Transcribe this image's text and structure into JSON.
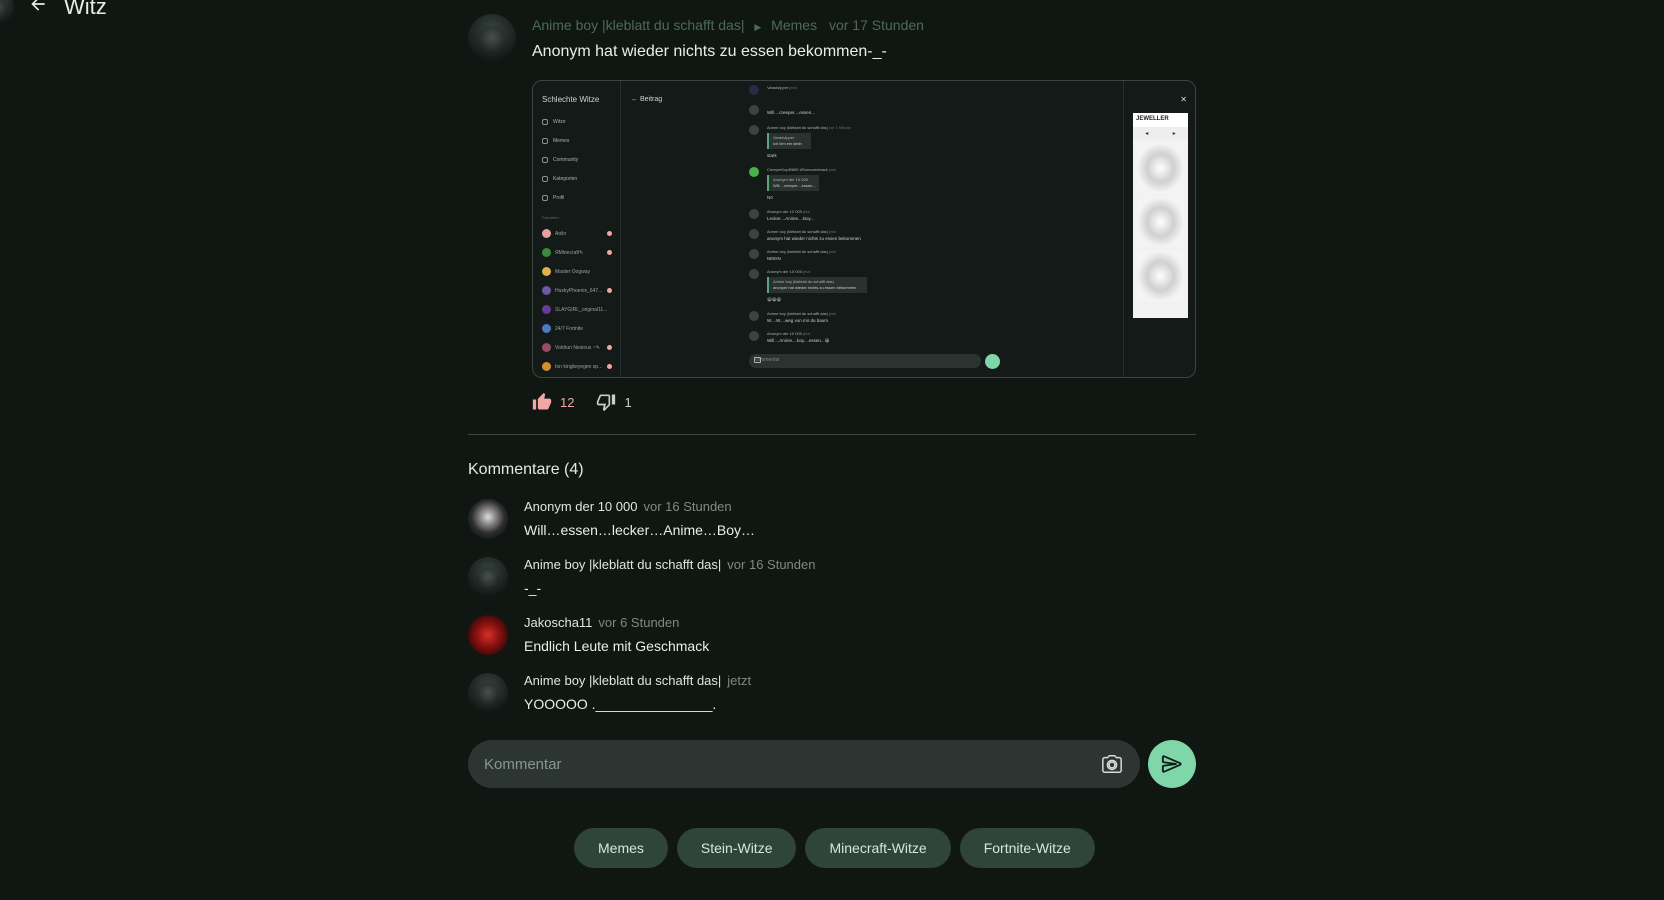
{
  "header": {
    "title": "Witz",
    "back_icon": "arrow-left-icon"
  },
  "post": {
    "author": "Anime boy |kleblatt du schafft das|",
    "category": "Memes",
    "time": "vor 17 Stunden",
    "text": "Anonym hat wieder nichts zu essen bekommen-_-",
    "likes": "12",
    "dislikes": "1",
    "embedded_screenshot": {
      "app_title": "Schlechte Witze",
      "back_label": "Beitrag",
      "nav": [
        "Witze",
        "Memes",
        "Community",
        "Kategorien",
        "Profil"
      ],
      "favorites_label": "Favoriten",
      "favorites": [
        "Aolin",
        "ЯМinecraft✎",
        "Master Oogway",
        "HuskyPhoenix_647...",
        "SLAYGIRL_original11...",
        "24/7 Fortnite",
        "Voldrun Nexious ~✎",
        "Ion kingkeyegen sp..."
      ],
      "comments": [
        {
          "name": "Varadvipper",
          "time": "jetzt",
          "text": ""
        },
        {
          "name": "",
          "time": "",
          "text": "Will....creeper....essen..."
        },
        {
          "name": "Anime boy |kleblatt du schafft das|",
          "time": "vor 1 Minute",
          "text": "stark"
        },
        {
          "name": "CreeperKopf0889 #Swecomeback",
          "time": "jetzt",
          "text": "Nö"
        },
        {
          "name": "Anonym der 10 000",
          "time": "jetzt",
          "text": "Lecker....Anime....Boy..."
        },
        {
          "name": "Anime boy |kleblatt du schafft das|",
          "time": "jetzt",
          "text": "anonym hat wieder nichts zu essen bekommen"
        },
        {
          "name": "Anime boy |kleblatt du schafft das|",
          "time": "jetzt",
          "text": "NEEIN"
        },
        {
          "name": "Anonym der 10 000",
          "time": "jetzt",
          "text": "😀😀😀"
        },
        {
          "name": "Anime boy |kleblatt du schafft das|",
          "time": "jetzt",
          "text": "W....W....weg von mir du baum"
        },
        {
          "name": "Anonym der 10 000",
          "time": "jetzt",
          "text": "Will....Anime....boy....essen...😀"
        }
      ],
      "quote_1": [
        "Varadvipper",
        "ich bim ein stein"
      ],
      "quote_2": [
        "Anonym der 10 000",
        "Will....creeper....essen..."
      ],
      "quote_3": [
        "Anime boy |kleblatt du schafft das|",
        "anonym hat wieder nichts zu essen bekommen"
      ],
      "input_placeholder": "Kommentar",
      "ad_brand": "JEWELLER"
    }
  },
  "comments_section": {
    "title": "Kommentare (4)",
    "items": [
      {
        "name": "Anonym der 10 000",
        "time": "vor 16 Stunden",
        "text": "Will…essen…lecker…Anime…Boy…"
      },
      {
        "name": "Anime boy |kleblatt du schafft das|",
        "time": "vor 16 Stunden",
        "text": "-_-"
      },
      {
        "name": "Jakoscha11",
        "time": "vor 6 Stunden",
        "text": "Endlich Leute mit Geschmack"
      },
      {
        "name": "Anime boy |kleblatt du schafft das|",
        "time": "jetzt",
        "text": "YOOOOO ._______________."
      }
    ]
  },
  "compose": {
    "placeholder": "Kommentar"
  },
  "categories": [
    "Memes",
    "Stein-Witze",
    "Minecraft-Witze",
    "Fortnite-Witze"
  ],
  "colors": {
    "background": "#101612",
    "accent": "#7fd6a8",
    "chip_bg": "#2f4539",
    "like": "#f2a6a6"
  }
}
